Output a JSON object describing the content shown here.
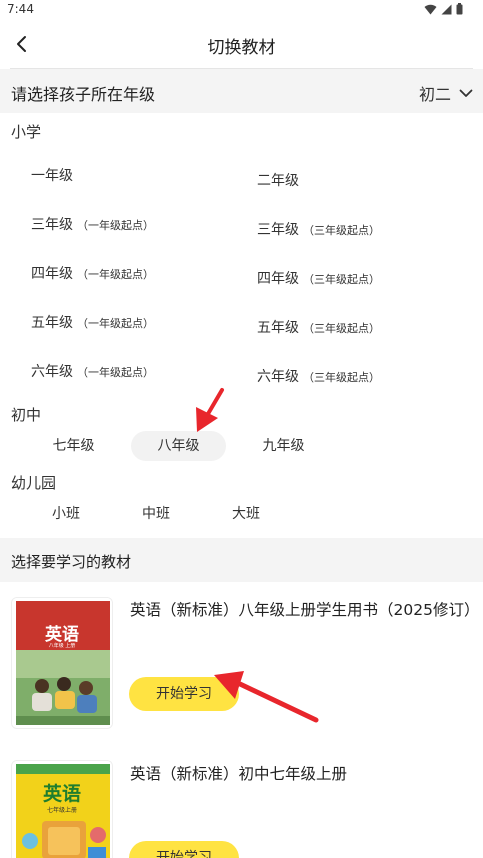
{
  "status": {
    "time": "7:44",
    "icons": [
      "wifi-icon",
      "signal-icon",
      "battery-icon"
    ]
  },
  "nav": {
    "title": "切换教材",
    "back_icon": "chevron-left-icon"
  },
  "grade_bar": {
    "label": "请选择孩子所在年级",
    "selected": "初二"
  },
  "primary": {
    "title": "小学",
    "left": [
      {
        "label": "一年级",
        "sub": ""
      },
      {
        "label": "三年级",
        "sub": "（一年级起点）"
      },
      {
        "label": "四年级",
        "sub": "（一年级起点）"
      },
      {
        "label": "五年级",
        "sub": "（一年级起点）"
      },
      {
        "label": "六年级",
        "sub": "（一年级起点）"
      }
    ],
    "right": [
      {
        "label": "二年级",
        "sub": ""
      },
      {
        "label": "三年级",
        "sub": "（三年级起点）"
      },
      {
        "label": "四年级",
        "sub": "（三年级起点）"
      },
      {
        "label": "五年级",
        "sub": "（三年级起点）"
      },
      {
        "label": "六年级",
        "sub": "（三年级起点）"
      }
    ]
  },
  "middle": {
    "title": "初中",
    "items": [
      "七年级",
      "八年级",
      "九年级"
    ],
    "selected": "八年级"
  },
  "kindergarten": {
    "title": "幼儿园",
    "items": [
      "小班",
      "中班",
      "大班"
    ]
  },
  "textbooks": {
    "header": "选择要学习的教材",
    "books": [
      {
        "title": "英语（新标准）八年级上册学生用书（2025修订）",
        "button": "开始学习",
        "cover_title": "英语",
        "cover_sub": "八年级 上册"
      },
      {
        "title": "英语（新标准）初中七年级上册",
        "button": "开始学习",
        "cover_title": "英语",
        "cover_sub": "七年级上册"
      }
    ]
  },
  "colors": {
    "accent_yellow": "#ffe342",
    "arrow_red": "#e8262c",
    "section_bg": "#f4f4f4",
    "cover1_red": "#c8362d",
    "cover2_yellow": "#f2d21a"
  }
}
